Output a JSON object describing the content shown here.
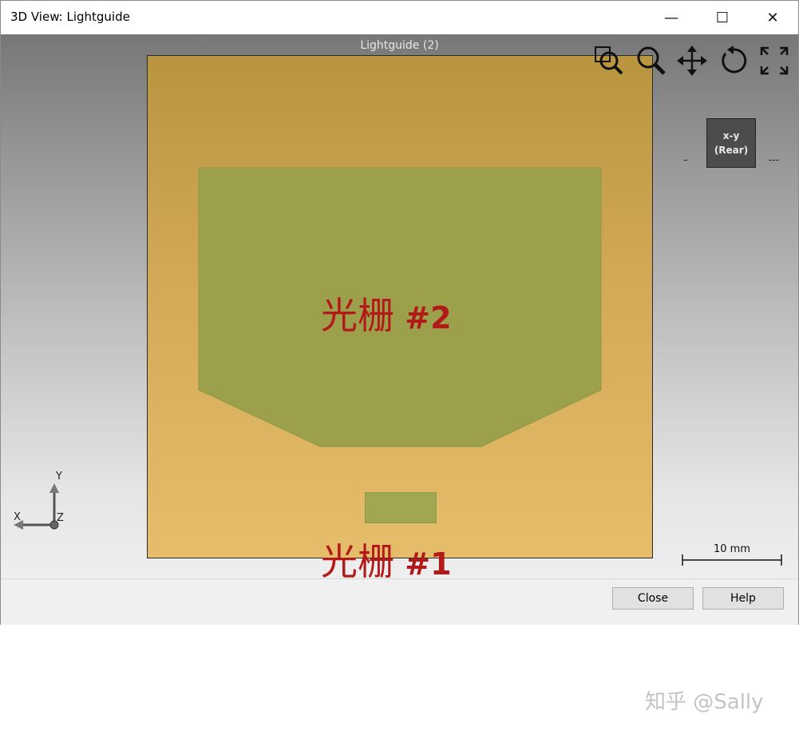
{
  "window": {
    "title": "3D View: Lightguide"
  },
  "title_controls": {
    "minimize": "—",
    "maximize": "☐",
    "close": "✕"
  },
  "viewport": {
    "title": "Lightguide (2)"
  },
  "toolbar": [
    {
      "icon": "zoom-region-icon"
    },
    {
      "icon": "zoom-icon"
    },
    {
      "icon": "pan-icon"
    },
    {
      "icon": "rotate-icon"
    },
    {
      "icon": "fit-view-icon"
    }
  ],
  "orientation": {
    "line1": "x-y",
    "line2": "(Rear)"
  },
  "axes": {
    "x": "X",
    "y": "Y",
    "z": "Z"
  },
  "scale": {
    "label": "10 mm"
  },
  "buttons": {
    "close": "Close",
    "help": "Help"
  },
  "annotations": {
    "grating2_cn": "光栅",
    "grating2_num": " #2",
    "grating1_cn": "光栅",
    "grating1_num": " #1"
  },
  "watermark": "知乎 @Sally",
  "colors": {
    "board": "#d2a957",
    "grating": "#a1a650",
    "annotation": "#b21919"
  }
}
